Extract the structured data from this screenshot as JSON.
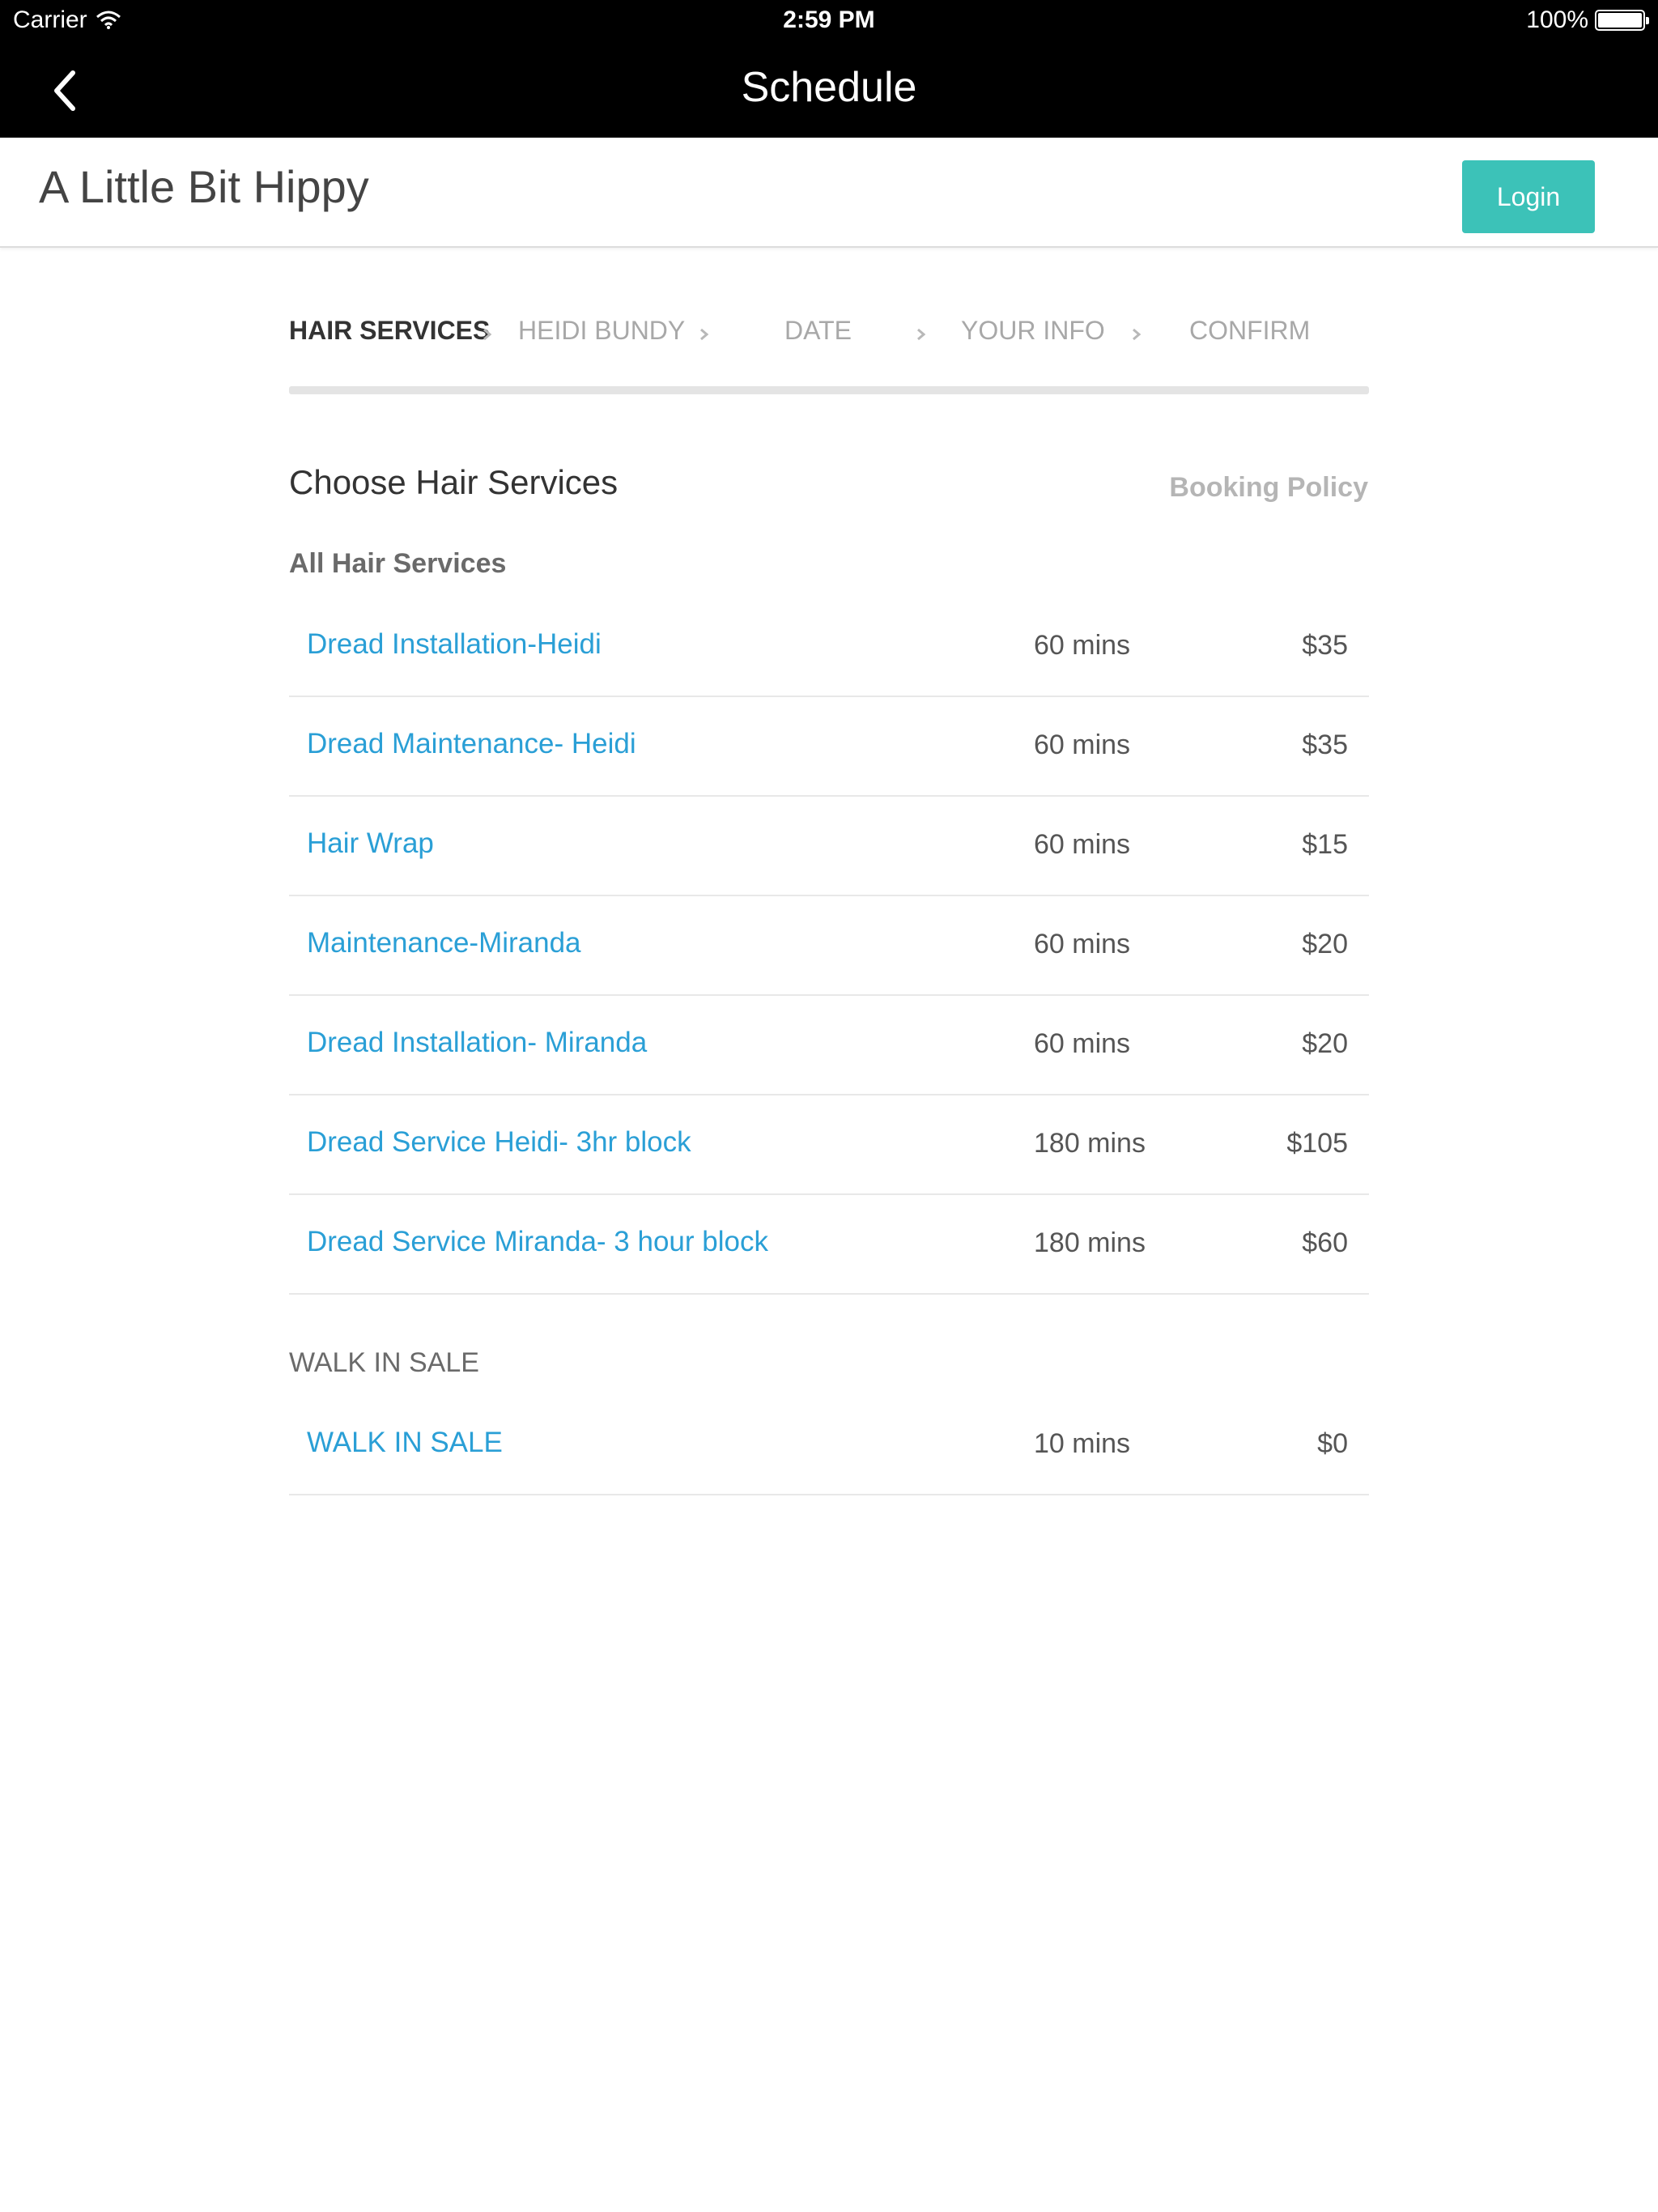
{
  "status_bar": {
    "carrier": "Carrier",
    "time": "2:59 PM",
    "battery": "100%"
  },
  "nav": {
    "title": "Schedule"
  },
  "business": {
    "name": "A Little Bit Hippy",
    "login_label": "Login",
    "accent_color": "#3cc2b8"
  },
  "steps": [
    {
      "label": "HAIR SERVICES",
      "active": true
    },
    {
      "label": "HEIDI BUNDY",
      "active": false
    },
    {
      "label": "DATE",
      "active": false
    },
    {
      "label": "YOUR INFO",
      "active": false
    },
    {
      "label": "CONFIRM",
      "active": false
    }
  ],
  "content": {
    "title": "Choose Hair Services",
    "policy_link": "Booking Policy"
  },
  "groups": [
    {
      "label": "All Hair Services",
      "services": [
        {
          "name": "Dread Installation-Heidi",
          "duration": "60 mins",
          "price": "$35"
        },
        {
          "name": "Dread Maintenance- Heidi",
          "duration": "60 mins",
          "price": "$35"
        },
        {
          "name": "Hair Wrap",
          "duration": "60 mins",
          "price": "$15"
        },
        {
          "name": "Maintenance-Miranda",
          "duration": "60 mins",
          "price": "$20"
        },
        {
          "name": "Dread Installation- Miranda",
          "duration": "60 mins",
          "price": "$20"
        },
        {
          "name": "Dread Service Heidi- 3hr block",
          "duration": "180 mins",
          "price": "$105"
        },
        {
          "name": "Dread Service Miranda- 3 hour block",
          "duration": "180 mins",
          "price": "$60"
        }
      ]
    },
    {
      "label": "WALK IN SALE",
      "services": [
        {
          "name": "WALK IN SALE",
          "duration": "10 mins",
          "price": "$0"
        }
      ]
    }
  ]
}
